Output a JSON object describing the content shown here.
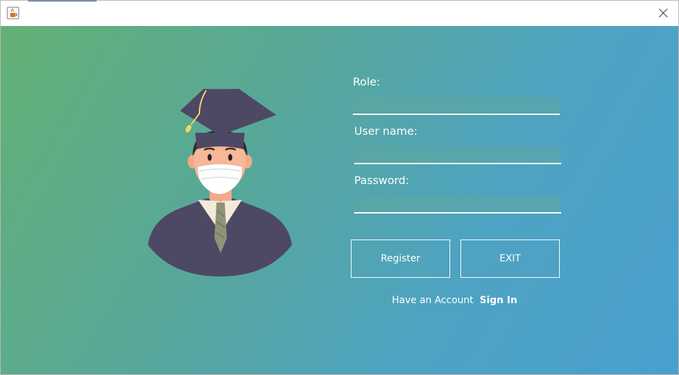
{
  "window": {
    "app_icon": "java-coffee-cup-icon",
    "close_icon": "close-x-icon"
  },
  "form": {
    "role_label": "Role:",
    "role_value": "",
    "username_label": "User name:",
    "username_value": "",
    "password_label": "Password:",
    "password_value": ""
  },
  "buttons": {
    "register_label": "Register",
    "exit_label": "EXIT"
  },
  "footer": {
    "have_account_text": "Have an Account",
    "sign_in_label": "Sign In"
  },
  "illustration": {
    "icon": "graduate-student-with-mask"
  },
  "colors": {
    "gradient_start": "#63b175",
    "gradient_end": "#4a9fcf",
    "gown": "#4d4863",
    "text": "#ffffff"
  }
}
